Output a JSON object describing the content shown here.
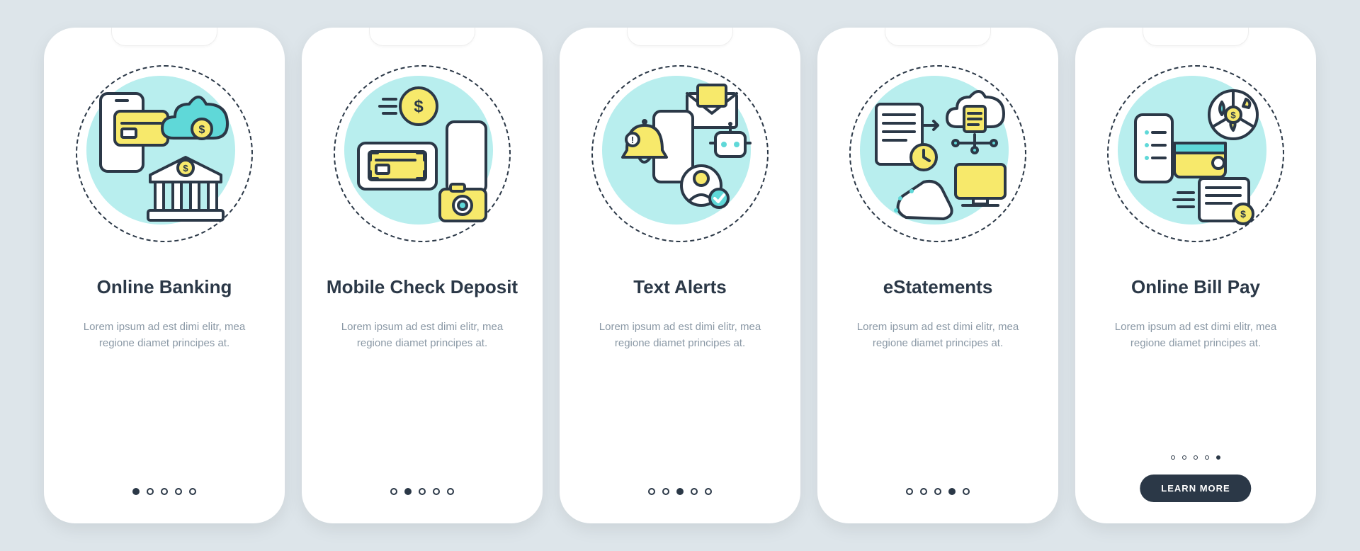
{
  "colors": {
    "bg": "#dde5ea",
    "ink": "#2b3847",
    "muted": "#8a98a5",
    "accentTeal": "#b8eeee",
    "accentYellow": "#f7e96b"
  },
  "lorem": "Lorem ipsum ad est dimi elitr, mea regione diamet principes at.",
  "learnMoreLabel": "LEARN MORE",
  "screens": [
    {
      "title": "Online Banking",
      "iconName": "online-banking-icon",
      "hasButton": false
    },
    {
      "title": "Mobile Check Deposit",
      "iconName": "mobile-deposit-icon",
      "hasButton": false
    },
    {
      "title": "Text Alerts",
      "iconName": "text-alerts-icon",
      "hasButton": false
    },
    {
      "title": "eStatements",
      "iconName": "estatements-icon",
      "hasButton": false
    },
    {
      "title": "Online Bill Pay",
      "iconName": "bill-pay-icon",
      "hasButton": true
    }
  ]
}
